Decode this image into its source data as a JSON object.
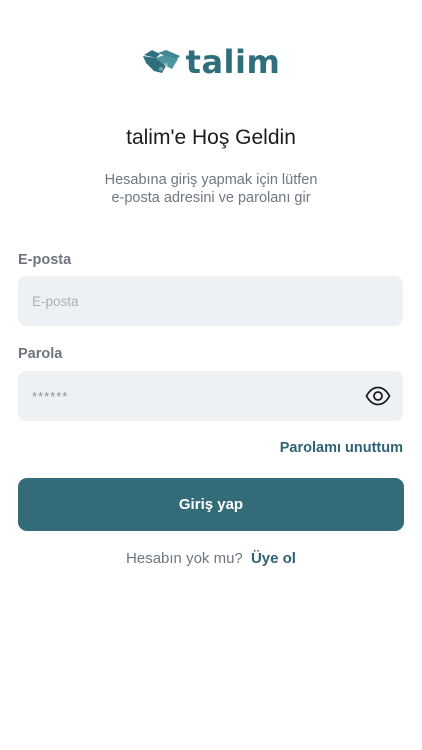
{
  "brand": {
    "name": "talim",
    "logo_icon": "handshake-icon",
    "color": "#2f6f7c"
  },
  "header": {
    "title": "talim'e Hoş Geldin",
    "subtitle_line1": "Hesabına giriş yapmak için lütfen",
    "subtitle_line2": "e-posta adresini ve parolanı gir"
  },
  "form": {
    "email": {
      "label": "E-posta",
      "placeholder": "E-posta",
      "value": ""
    },
    "password": {
      "label": "Parola",
      "masked_value": "******",
      "visibility_icon": "eye-icon"
    },
    "forgot_password": "Parolamı unuttum",
    "submit_label": "Giriş yap"
  },
  "signup": {
    "question": "Hesabın yok mu?",
    "link": "Üye ol"
  },
  "colors": {
    "primary": "#336b78",
    "link": "#2f6373",
    "input_bg": "#eef1f4"
  }
}
